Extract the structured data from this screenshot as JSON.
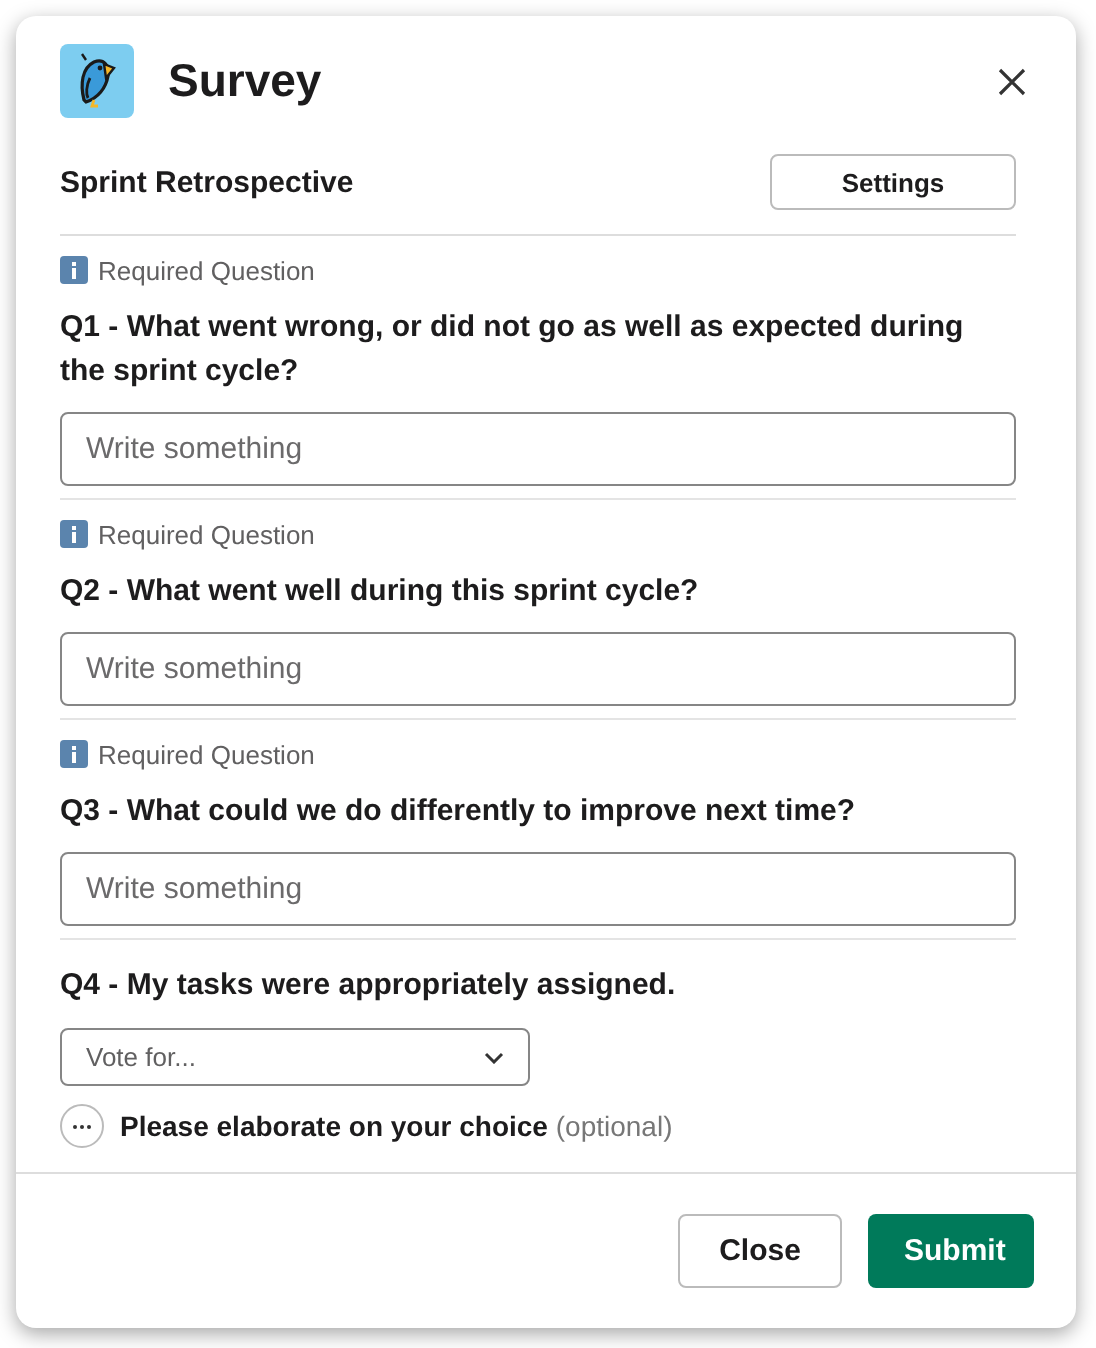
{
  "window": {
    "title": "Survey"
  },
  "survey": {
    "name": "Sprint Retrospective",
    "settings_button": "Settings"
  },
  "questions": [
    {
      "kind": "text",
      "notice": "Required Question",
      "label": "Q1 - What went wrong, or did not go as well as expected during the sprint cycle?",
      "placeholder": "Write something"
    },
    {
      "kind": "text",
      "notice": "Required Question",
      "label": "Q2 - What went well during this sprint cycle?",
      "placeholder": "Write something"
    },
    {
      "kind": "text",
      "notice": "Required Question",
      "label": "Q3 - What could we do differently to improve next time?",
      "placeholder": "Write something"
    },
    {
      "kind": "select",
      "label": "Q4 - My tasks were appropriately assigned.",
      "placeholder": "Vote for..."
    },
    {
      "kind": "elaborate",
      "label": "Please elaborate on your choice",
      "note": "(optional)"
    }
  ],
  "buttons": [
    {
      "kind": "secondary",
      "label": "Close"
    },
    {
      "kind": "primary",
      "label": "Submit"
    }
  ]
}
